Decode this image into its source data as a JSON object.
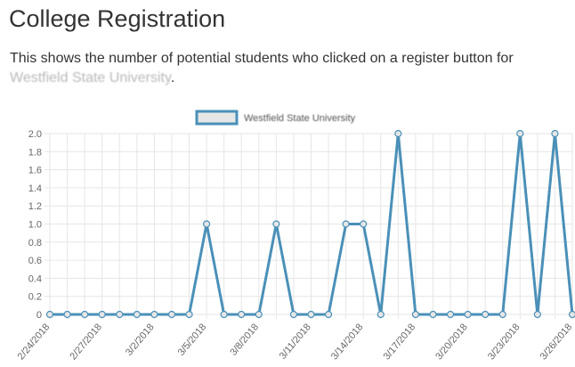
{
  "page": {
    "title": "College Registration",
    "description_prefix": "This shows the number of potential students who clicked on a register button for ",
    "description_university": "Westfield State University",
    "description_suffix": "."
  },
  "chart_data": {
    "type": "line",
    "x": [
      "2/24/2018",
      "2/25/2018",
      "2/26/2018",
      "2/27/2018",
      "2/28/2018",
      "3/1/2018",
      "3/2/2018",
      "3/3/2018",
      "3/4/2018",
      "3/5/2018",
      "3/6/2018",
      "3/7/2018",
      "3/8/2018",
      "3/9/2018",
      "3/10/2018",
      "3/11/2018",
      "3/12/2018",
      "3/13/2018",
      "3/14/2018",
      "3/15/2018",
      "3/16/2018",
      "3/17/2018",
      "3/18/2018",
      "3/19/2018",
      "3/20/2018",
      "3/21/2018",
      "3/22/2018",
      "3/23/2018",
      "3/24/2018",
      "3/25/2018",
      "3/26/2018"
    ],
    "x_tick_labels": [
      "2/24/2018",
      "2/27/2018",
      "3/2/2018",
      "3/5/2018",
      "3/8/2018",
      "3/11/2018",
      "3/14/2018",
      "3/17/2018",
      "3/20/2018",
      "3/23/2018",
      "3/26/2018"
    ],
    "series": [
      {
        "name": "Westfield State University",
        "values": [
          0,
          0,
          0,
          0,
          0,
          0,
          0,
          0,
          0,
          1,
          0,
          0,
          0,
          1,
          0,
          0,
          0,
          1,
          1,
          0,
          2,
          0,
          0,
          0,
          0,
          0,
          0,
          2,
          0,
          2,
          0
        ],
        "color": "#4a90b8",
        "fill_color": "#e6e6e6"
      }
    ],
    "y_ticks": [
      "2.0",
      "1.8",
      "1.6",
      "1.4",
      "1.2",
      "1.0",
      "0.8",
      "0.6",
      "0.4",
      "0.2",
      "0"
    ],
    "ylim": [
      0,
      2
    ],
    "grid": true,
    "legend_position": "top-center"
  }
}
